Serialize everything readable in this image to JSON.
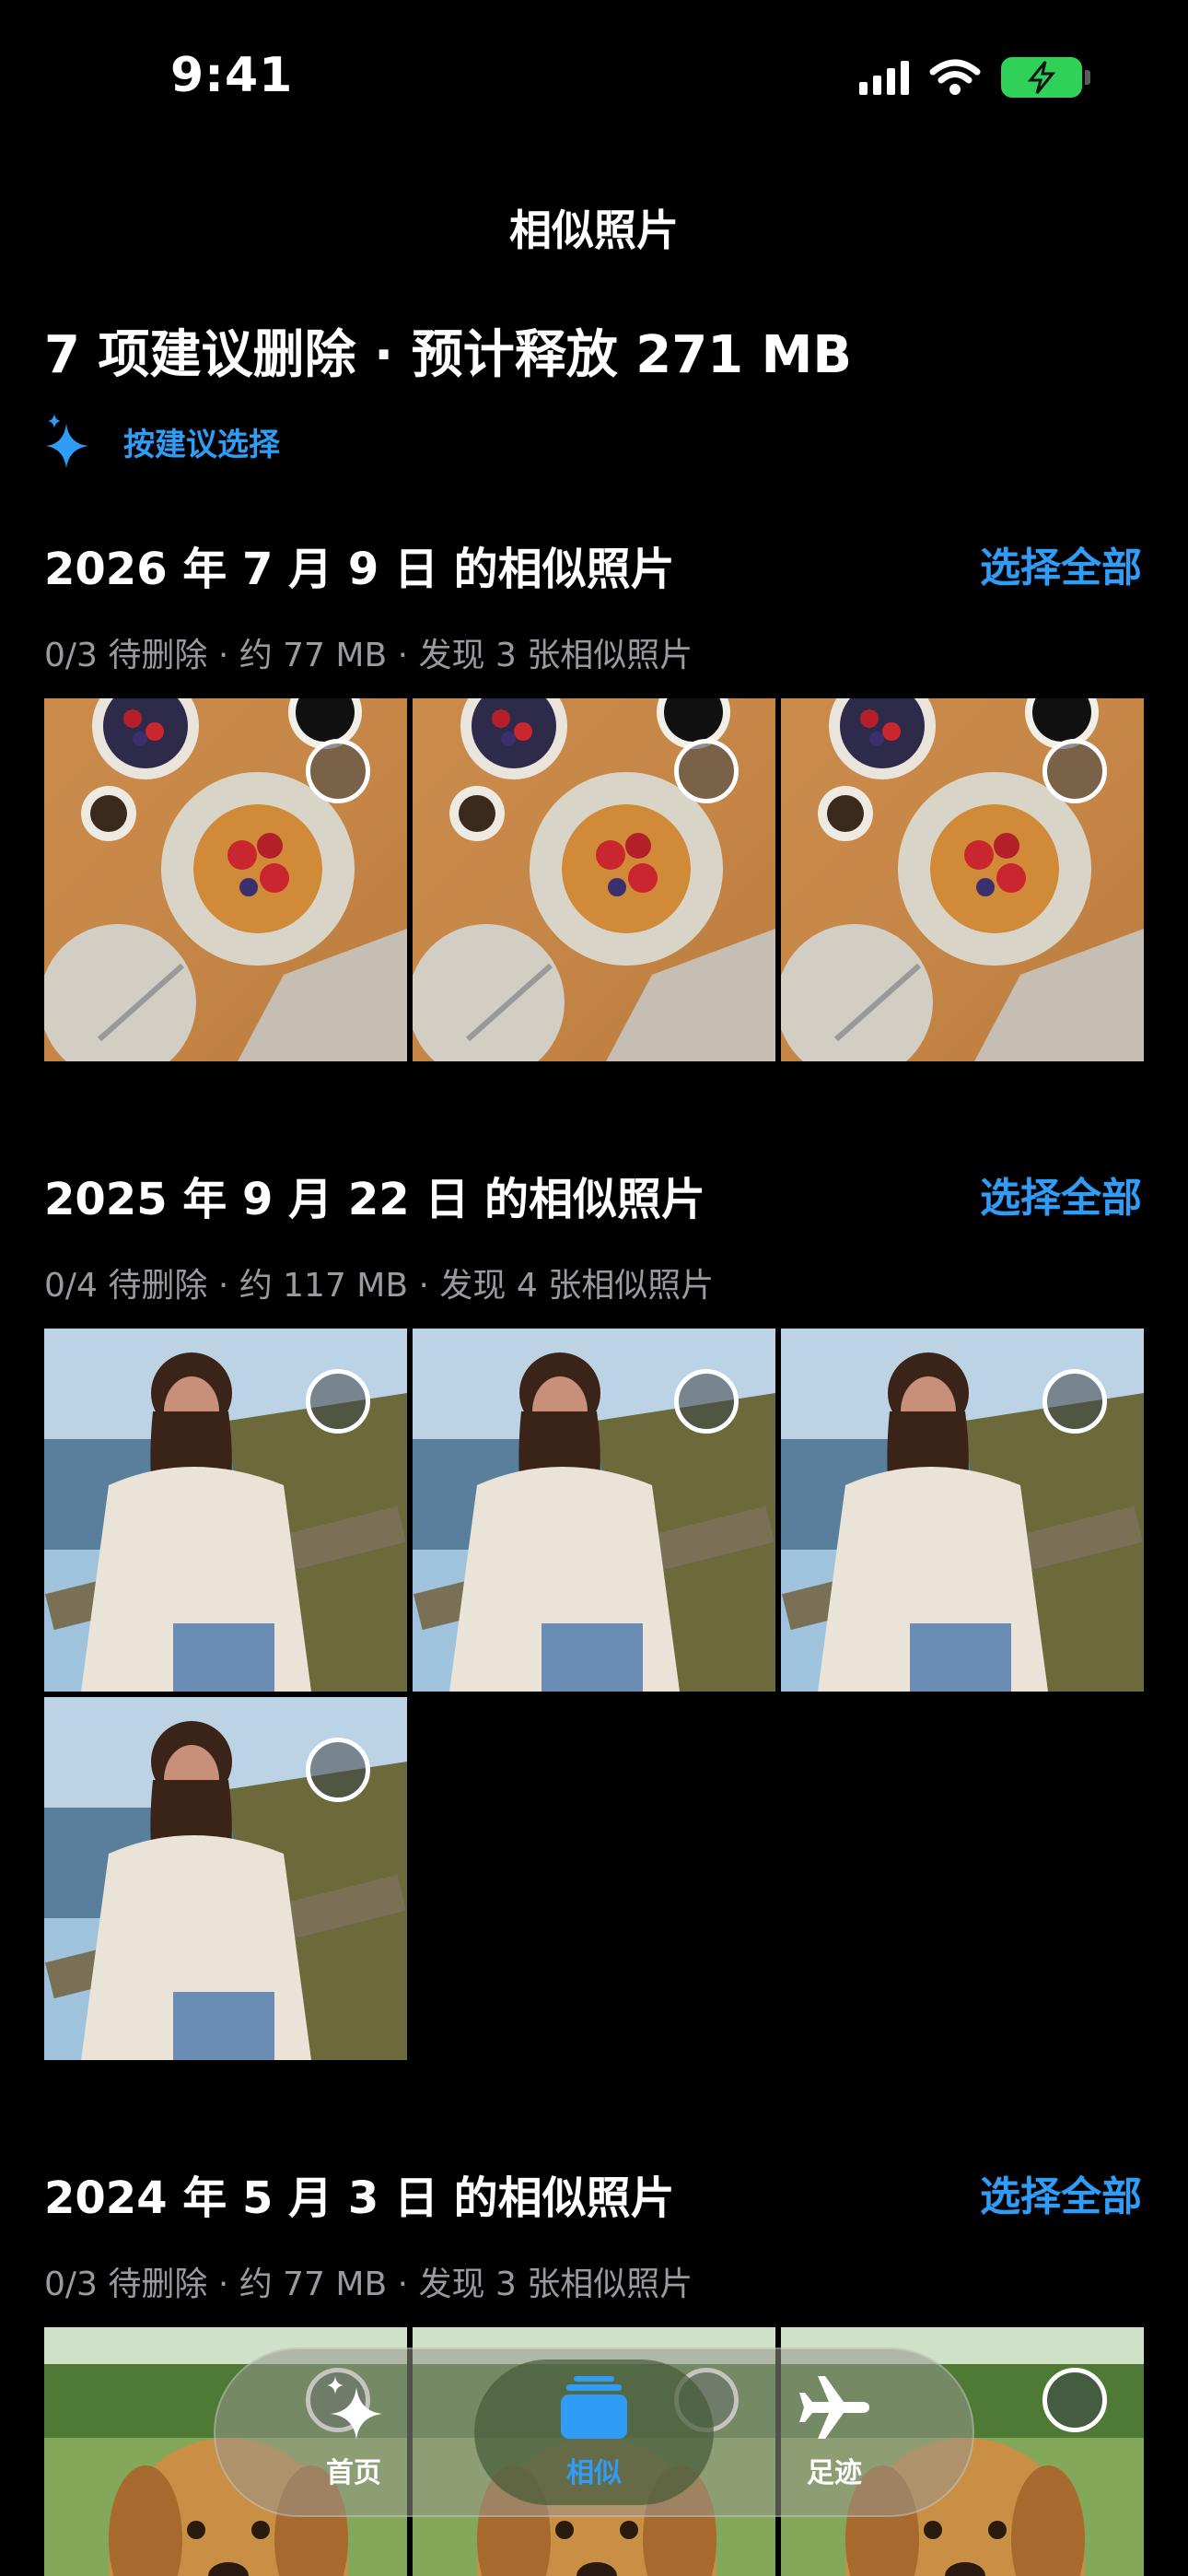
{
  "status_bar": {
    "time": "9:41"
  },
  "nav": {
    "title": "相似照片"
  },
  "summary": {
    "text": "7 项建议删除 · 预计释放 271 MB"
  },
  "suggest": {
    "label": "按建议选择"
  },
  "groups": [
    {
      "title": "2026 年 7 月 9 日 的相似照片",
      "select_all": "选择全部",
      "meta": "0/3 待删除 · 约 77 MB   ·   发现 3 张相似照片",
      "photo_type": "breakfast",
      "photo_count": 3
    },
    {
      "title": "2025 年 9 月 22 日 的相似照片",
      "select_all": "选择全部",
      "meta": "0/4 待删除 · 约 117 MB   ·   发现 4 张相似照片",
      "photo_type": "portrait",
      "photo_count": 4
    },
    {
      "title": "2024 年 5 月 3 日 的相似照片",
      "select_all": "选择全部",
      "meta": "0/3 待删除 · 约 77 MB   ·   发现 3 张相似照片",
      "photo_type": "dog",
      "photo_count": 3
    }
  ],
  "tabbar": {
    "tabs": [
      {
        "label": "首页",
        "icon": "sparkles-icon",
        "active": false
      },
      {
        "label": "相似",
        "icon": "stack-icon",
        "active": true
      },
      {
        "label": "足迹",
        "icon": "airplane-icon",
        "active": false
      }
    ]
  },
  "colors": {
    "accent": "#2f9cf5",
    "background": "#000000",
    "battery": "#30d158"
  }
}
